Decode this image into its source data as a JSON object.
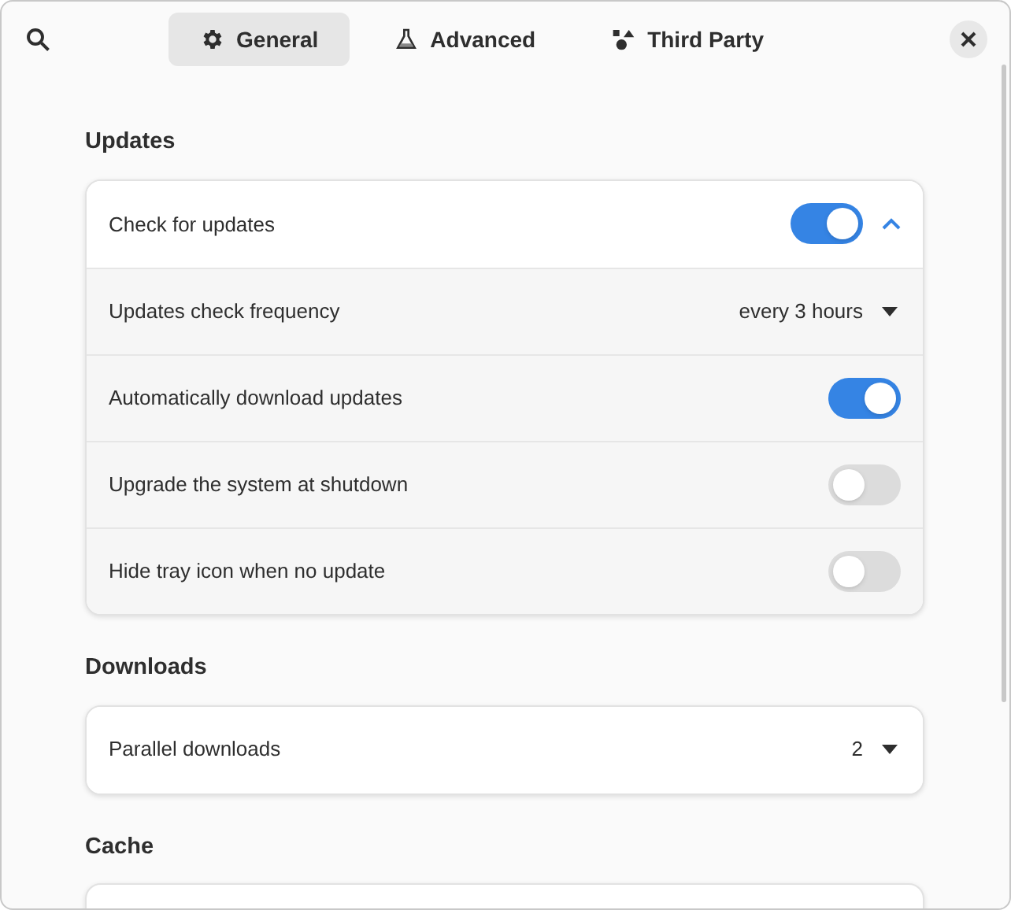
{
  "tabs": [
    {
      "label": "General",
      "selected": true
    },
    {
      "label": "Advanced",
      "selected": false
    },
    {
      "label": "Third Party",
      "selected": false
    }
  ],
  "sections": [
    {
      "title": "Updates",
      "rows": [
        {
          "kind": "switch_expander",
          "label": "Check for updates",
          "on": true,
          "expanded": true,
          "children": [
            {
              "kind": "dropdown",
              "label": "Updates check frequency",
              "value": "every 3 hours"
            },
            {
              "kind": "switch",
              "label": "Automatically download updates",
              "on": true
            },
            {
              "kind": "switch",
              "label": "Upgrade the system at shutdown",
              "on": false
            },
            {
              "kind": "switch",
              "label": "Hide tray icon when no update",
              "on": false
            }
          ]
        }
      ]
    },
    {
      "title": "Downloads",
      "rows": [
        {
          "kind": "dropdown",
          "label": "Parallel downloads",
          "value": "2"
        }
      ]
    },
    {
      "title": "Cache"
    }
  ]
}
